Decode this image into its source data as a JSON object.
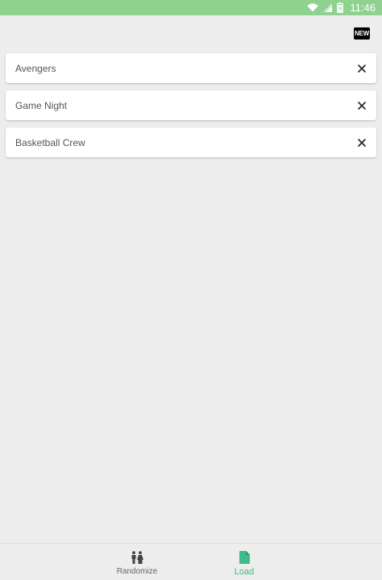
{
  "status_bar": {
    "time": "11:46",
    "wifi_icon": "wifi-icon",
    "signal_icon": "signal-icon",
    "battery_icon": "battery-icon",
    "background_color": "#8fd18f"
  },
  "toolbar": {
    "new_label": "NEW"
  },
  "groups": [
    {
      "name": "Avengers"
    },
    {
      "name": "Game Night"
    },
    {
      "name": "Basketball Crew"
    }
  ],
  "bottom_nav": {
    "items": [
      {
        "label": "Randomize",
        "icon": "people-icon",
        "active": false
      },
      {
        "label": "Load",
        "icon": "file-icon",
        "active": true
      }
    ],
    "active_color": "#3dbb8a"
  }
}
